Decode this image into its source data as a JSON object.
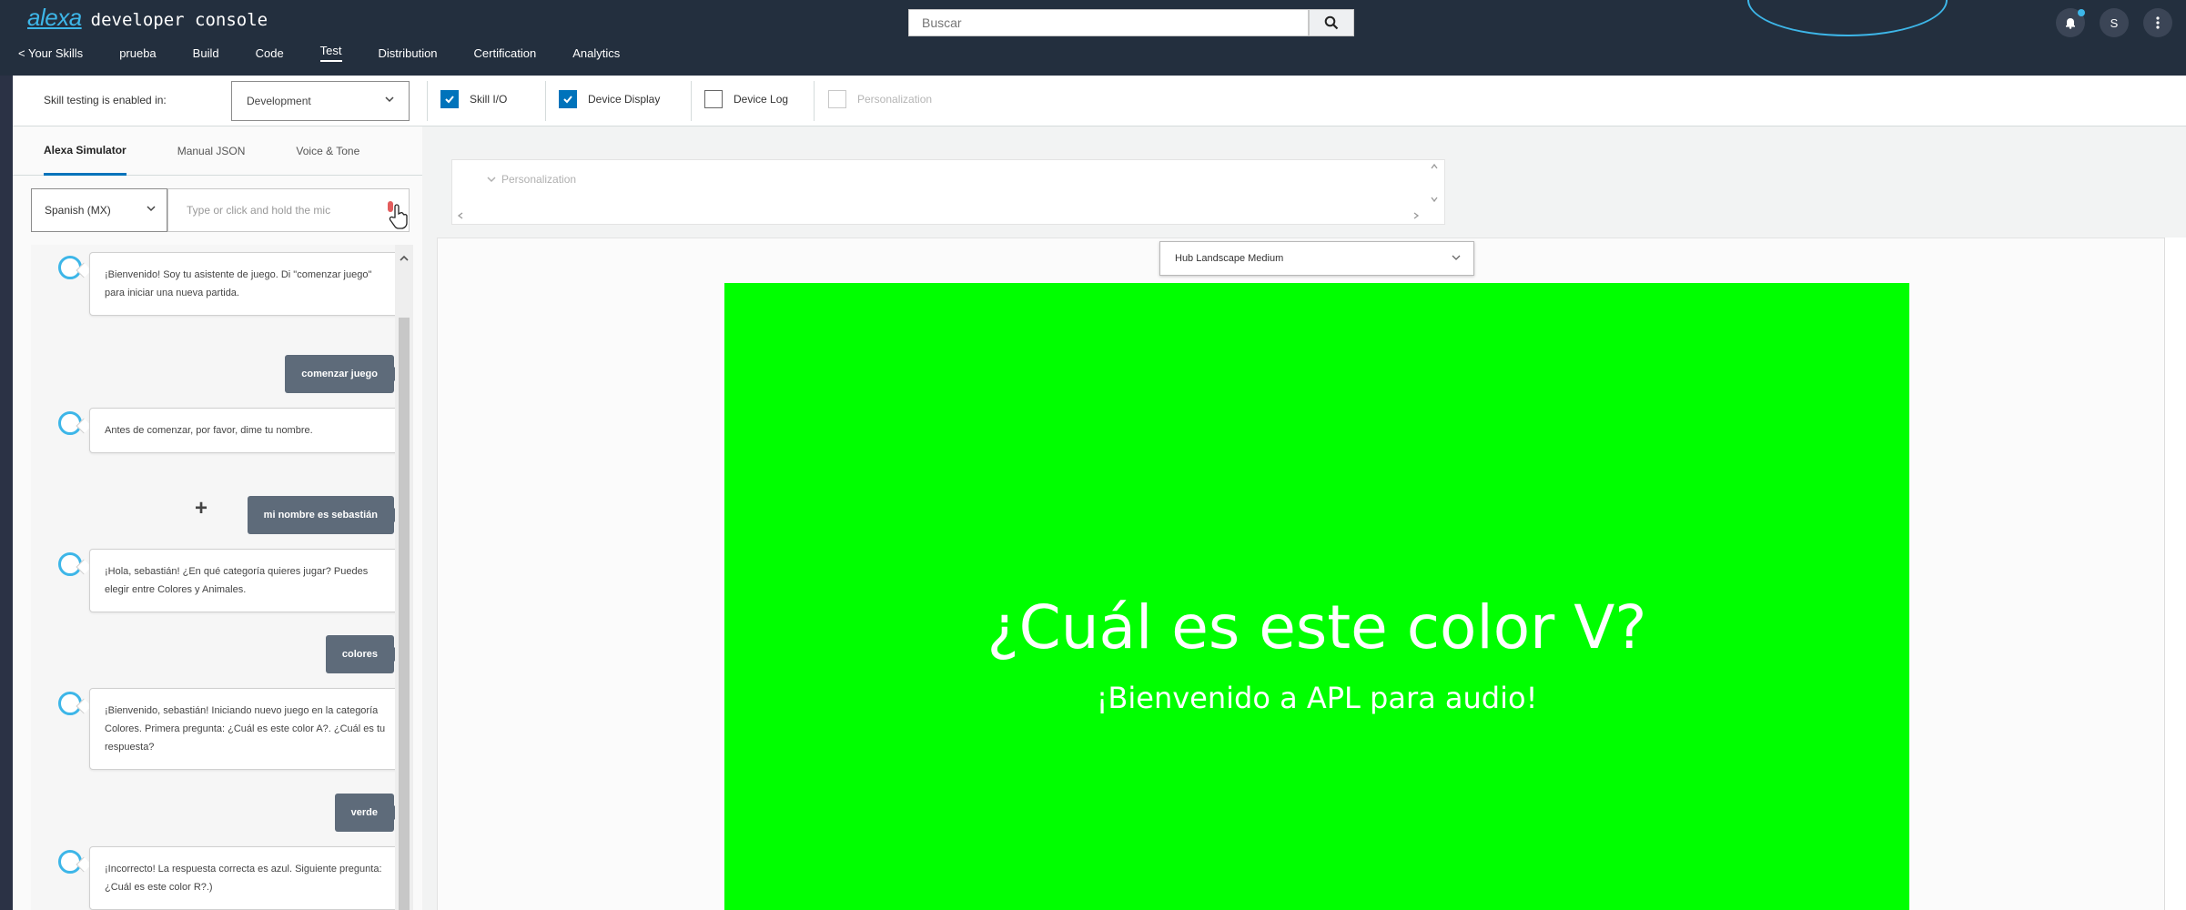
{
  "header": {
    "logo_mark": "alexa",
    "logo_text": "developer console",
    "search_placeholder": "Buscar",
    "user_initial": "S",
    "nav": [
      "< Your Skills",
      "prueba",
      "Build",
      "Code",
      "Test",
      "Distribution",
      "Certification",
      "Analytics"
    ],
    "active_nav": "Test"
  },
  "toolbar": {
    "testing_label": "Skill testing is enabled in:",
    "stage": "Development",
    "checkboxes": [
      {
        "label": "Skill I/O",
        "checked": true
      },
      {
        "label": "Device Display",
        "checked": true
      },
      {
        "label": "Device Log",
        "checked": false
      },
      {
        "label": "Personalization",
        "checked": false,
        "disabled": true
      }
    ]
  },
  "simulator": {
    "tabs": [
      "Alexa Simulator",
      "Manual JSON",
      "Voice & Tone"
    ],
    "active_tab": "Alexa Simulator",
    "language": "Spanish (MX)",
    "input_placeholder": "Type or click and hold the mic",
    "messages": [
      {
        "from": "alexa",
        "text": "¡Bienvenido! Soy tu asistente de juego. Di \"comenzar juego\" para iniciar una nueva partida."
      },
      {
        "from": "user",
        "text": "comenzar juego"
      },
      {
        "from": "alexa",
        "text": "Antes de comenzar, por favor, dime tu nombre."
      },
      {
        "from": "user",
        "text": "mi nombre es sebastián"
      },
      {
        "from": "alexa",
        "text": "¡Hola, sebastián! ¿En qué categoría quieres jugar? Puedes elegir entre Colores y Animales."
      },
      {
        "from": "user",
        "text": "colores"
      },
      {
        "from": "alexa",
        "text": "¡Bienvenido, sebastián! Iniciando nuevo juego en la categoría Colores. Primera pregunta: ¿Cuál es este color A?. ¿Cuál es tu respuesta?"
      },
      {
        "from": "user",
        "text": "verde"
      },
      {
        "from": "alexa",
        "text": "¡Incorrecto! La respuesta correcta es azul. Siguiente pregunta: ¿Cuál es este color R?.)"
      }
    ]
  },
  "display": {
    "personalization_label": "Personalization",
    "device": "Hub Landscape Medium",
    "screen_bg": "#00ff00",
    "title": "¿Cuál es este color V?",
    "subtitle": "¡Bienvenido a APL para audio!"
  },
  "colors": {
    "header_bg": "#232f3e",
    "accent": "#3db6e8",
    "checkbox_on": "#0073bb",
    "user_bubble": "#5e6b7a"
  }
}
